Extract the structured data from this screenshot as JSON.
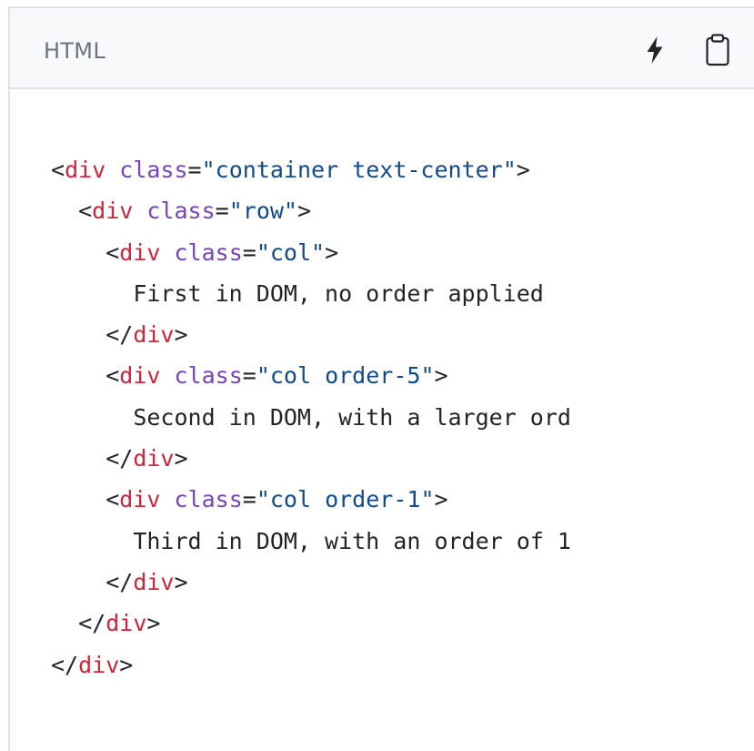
{
  "header": {
    "language_label": "HTML",
    "run_icon": "lightning-icon",
    "copy_icon": "clipboard-icon"
  },
  "code": {
    "lines": [
      {
        "indent": "",
        "open": "<",
        "tag": "div",
        "attr": "class",
        "eq": "=",
        "value": "\"container text-center\"",
        "close": ">"
      },
      {
        "indent": "  ",
        "open": "<",
        "tag": "div",
        "attr": "class",
        "eq": "=",
        "value": "\"row\"",
        "close": ">"
      },
      {
        "indent": "    ",
        "open": "<",
        "tag": "div",
        "attr": "class",
        "eq": "=",
        "value": "\"col\"",
        "close": ">"
      },
      {
        "indent": "      ",
        "text": "First in DOM, no order applied"
      },
      {
        "indent": "    ",
        "open": "</",
        "tag": "div",
        "close": ">"
      },
      {
        "indent": "    ",
        "open": "<",
        "tag": "div",
        "attr": "class",
        "eq": "=",
        "value": "\"col order-5\"",
        "close": ">"
      },
      {
        "indent": "      ",
        "text": "Second in DOM, with a larger ord"
      },
      {
        "indent": "    ",
        "open": "</",
        "tag": "div",
        "close": ">"
      },
      {
        "indent": "    ",
        "open": "<",
        "tag": "div",
        "attr": "class",
        "eq": "=",
        "value": "\"col order-1\"",
        "close": ">"
      },
      {
        "indent": "      ",
        "text": "Third in DOM, with an order of 1"
      },
      {
        "indent": "    ",
        "open": "</",
        "tag": "div",
        "close": ">"
      },
      {
        "indent": "  ",
        "open": "</",
        "tag": "div",
        "close": ">"
      },
      {
        "indent": "",
        "open": "</",
        "tag": "div",
        "close": ">"
      }
    ]
  }
}
